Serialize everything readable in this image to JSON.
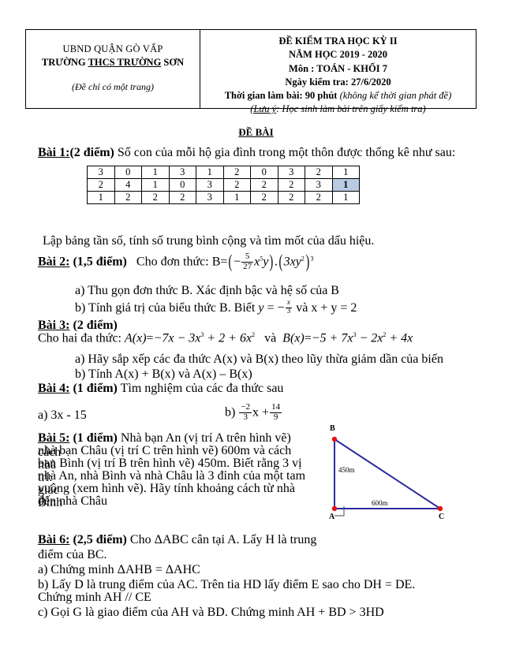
{
  "header": {
    "left": {
      "line1": "UBND QUẬN GÒ VẤP",
      "line2_pre": "TRƯỜNG",
      "line2_underlined": "THCS TRƯỜNG",
      "line2_post": "SƠN",
      "note": "(Đề chỉ có một trang)"
    },
    "right": {
      "line1": "ĐỀ KIỂM TRA HỌC KỲ II",
      "line2": "NĂM HỌC 2019 - 2020",
      "line3": "Môn : TOÁN - KHỐI 7",
      "line4": "Ngày kiểm tra: 27/6/2020",
      "line5_bold": "Thời  gian làm bài: 90 phút",
      "line5_italic": "(không kể thời gian phát đề)",
      "line6_prefix": "(Lưu ý",
      "line6_rest": ": Học sinh làm bài trên giấy kiểm tra)"
    }
  },
  "title": "ĐỀ BÀI",
  "bai1": {
    "label": "Bài 1:",
    "points": "(2 điểm)",
    "text": "Số con của mỗi hộ gia đình trong một thôn được thống kê như sau:",
    "table": [
      [
        "3",
        "0",
        "1",
        "3",
        "1",
        "2",
        "0",
        "3",
        "2",
        "1"
      ],
      [
        "2",
        "4",
        "1",
        "0",
        "3",
        "2",
        "2",
        "2",
        "3",
        "1"
      ],
      [
        "1",
        "2",
        "2",
        "2",
        "3",
        "1",
        "2",
        "2",
        "2",
        "1"
      ]
    ],
    "cursor_cell": {
      "row": 1,
      "col": 9
    },
    "followup": "Lập bảng tần số, tính số trung bình cộng và tìm mốt của dấu hiệu."
  },
  "bai2": {
    "label": "Bài 2:",
    "points": "(1,5 điểm)",
    "intro": "Cho đơn thức: B",
    "equals": "=",
    "frac_num": "5",
    "frac_den": "27",
    "minus": "−",
    "monomial": "x",
    "monomial_exp": "5",
    "monomial_y": "y",
    "factor": "3xy",
    "factor_exp": "2",
    "factor_power": "3",
    "a": "a) Thu gọn đơn thức B. Xác định bậc và hệ số của B",
    "b_pre": "b) Tính giá trị của biểu thức B. Biết ",
    "b_y": "y",
    "b_eq": "=",
    "b_minus": "−",
    "b_frac_num": "x",
    "b_frac_den": "3",
    "b_post": " và x + y = 2"
  },
  "bai3": {
    "label": "Bài 3:",
    "points": "(2 điểm)",
    "intro": "Cho hai đa thức:",
    "A_name": "A",
    "A_arg": "(x)",
    "A_expr_eq": "=",
    "A_expr": "−7x − 3x",
    "A_exp1": "3",
    "A_expr2": " + 2 + 6x",
    "A_exp2": "2",
    "va": "và",
    "B_name": "B",
    "B_arg": "(x)",
    "B_expr_eq": "=",
    "B_expr": "−5 + 7x",
    "B_exp1": "3",
    "B_expr2": " − 2x",
    "B_exp2": "2",
    "B_expr3": " + 4x",
    "a": "a) Hãy sắp xếp các đa thức A(x) và B(x) theo lũy thừa giảm dần của biến",
    "b": "b) Tính A(x) + B(x)  và  A(x) – B(x)"
  },
  "bai4": {
    "label": "Bài 4:",
    "points": "(1 điểm)",
    "text": "Tìm nghiệm của các đa thức sau",
    "a": "a) 3x - 15",
    "b_label": "b)",
    "b_num": "−2",
    "b_den": "3",
    "b_mid": "x +",
    "b_num2": "14",
    "b_den2": "9"
  },
  "bai5": {
    "label": "Bài 5:",
    "points": "(1 điểm)",
    "lines": [
      "Nhà bạn An (vị trí A trên hình vẽ) cách",
      "nhà bạn Châu (vị trí C trên hình vẽ) 600m và cách nhà",
      "bạn Bình (vị trí B trên hình vẽ) 450m. Biết rằng 3 vị trí:",
      "nhà An, nhà Bình và nhà Châu là 3 đỉnh của một tam giác",
      "vuông (xem hình vẽ). Hãy tính khoảng cách từ nhà Bình",
      "đến nhà Châu"
    ],
    "figure": {
      "vertex_B": "B",
      "vertex_A": "A",
      "vertex_C": "C",
      "len_AB": "450m",
      "len_AC": "600m",
      "line_color": "#2b2b9e",
      "point_color": "#e8120c",
      "right_angle_color": "#808080"
    }
  },
  "bai6": {
    "label": "Bài 6:",
    "points": "(2,5 điểm)",
    "lines": [
      "Cho ΔABC cân tại A. Lấy H là trung",
      "điểm của BC.",
      "a) Chứng minh ΔAHB = ΔAHC",
      "b) Lấy D là trung điểm của AC. Trên tia HD lấy điểm E sao cho DH = DE.",
      "Chứng minh AH // CE",
      "c) Gọi G là giao điểm của AH và BD. Chứng minh AH + BD > 3HD"
    ]
  }
}
